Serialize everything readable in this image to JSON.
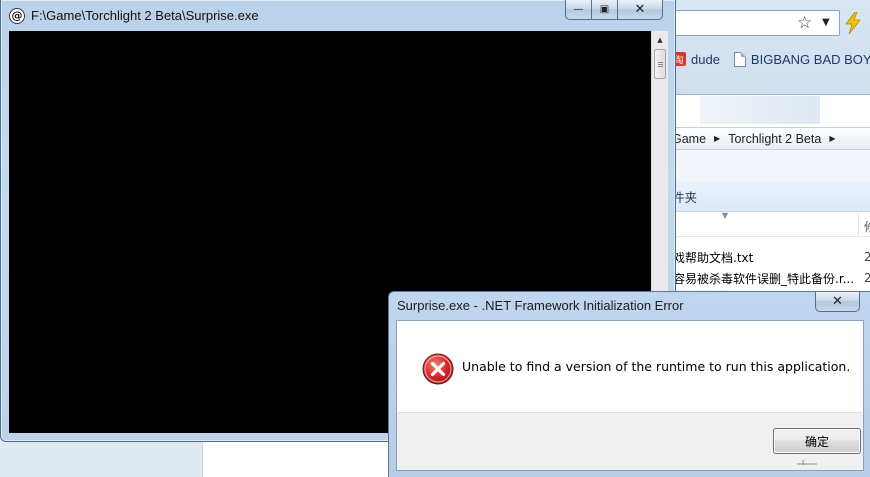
{
  "browser": {
    "bookmarks": [
      {
        "icon": "red-app-icon",
        "icon_glyph": "淘",
        "label": "dude"
      },
      {
        "icon": "page-icon",
        "label": "BIGBANG BAD BOY"
      }
    ]
  },
  "explorer": {
    "breadcrumb": [
      "Game",
      "Torchlight 2 Beta"
    ],
    "folder_label": "件夹",
    "column_header": "修",
    "files": [
      {
        "name": "戏帮助文档.txt",
        "date": "2"
      },
      {
        "name": "容易被杀毒软件误删_特此备份.r...",
        "date": "2"
      }
    ]
  },
  "console": {
    "title": "F:\\Game\\Torchlight 2 Beta\\Surprise.exe",
    "icon_glyph": "@",
    "background_color": "#000000",
    "minimize_glyph": "—",
    "maximize_glyph": "▣",
    "close_glyph": "✕"
  },
  "dialog": {
    "title": "Surprise.exe - .NET Framework Initialization Error",
    "message": "Unable to find a version of the runtime to run this application.",
    "ok_label": "确定",
    "close_glyph": "✕",
    "icon": "error-icon",
    "icon_color": "#c8282e"
  },
  "colors": {
    "titlebar": "#bcd2ea",
    "dialog_footer": "#f0f0f0"
  }
}
